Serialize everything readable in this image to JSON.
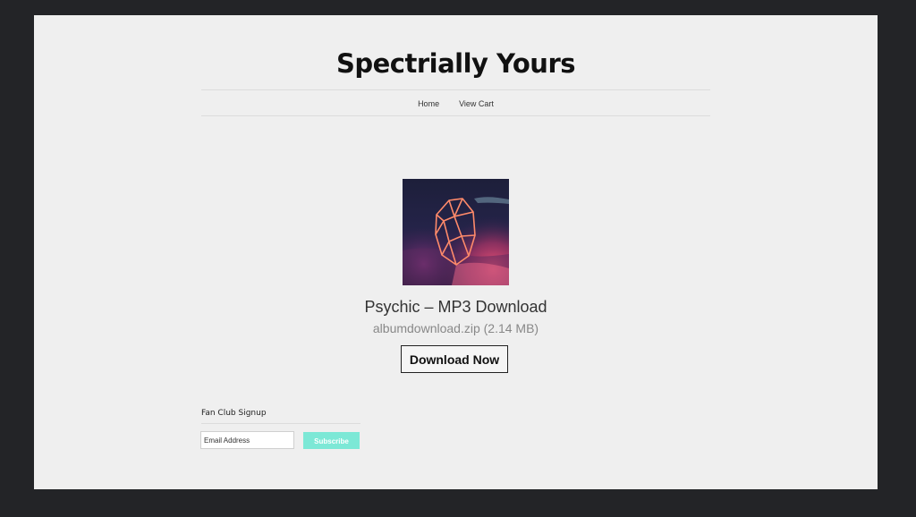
{
  "site": {
    "title": "Spectrially Yours"
  },
  "nav": {
    "items": [
      {
        "label": "Home"
      },
      {
        "label": "View Cart"
      }
    ]
  },
  "product": {
    "title": "Psychic – MP3 Download",
    "file_info": "albumdownload.zip (2.14 MB)",
    "download_label": "Download Now",
    "cover_icon": "crystal-gem-artwork"
  },
  "signup": {
    "heading": "Fan Club Signup",
    "email_placeholder": "Email Address",
    "email_value": "",
    "subscribe_label": "Subscribe"
  },
  "colors": {
    "background": "#232427",
    "page": "#efefef",
    "subscribe_accent": "#7ce8d6",
    "title_text": "#111111"
  }
}
